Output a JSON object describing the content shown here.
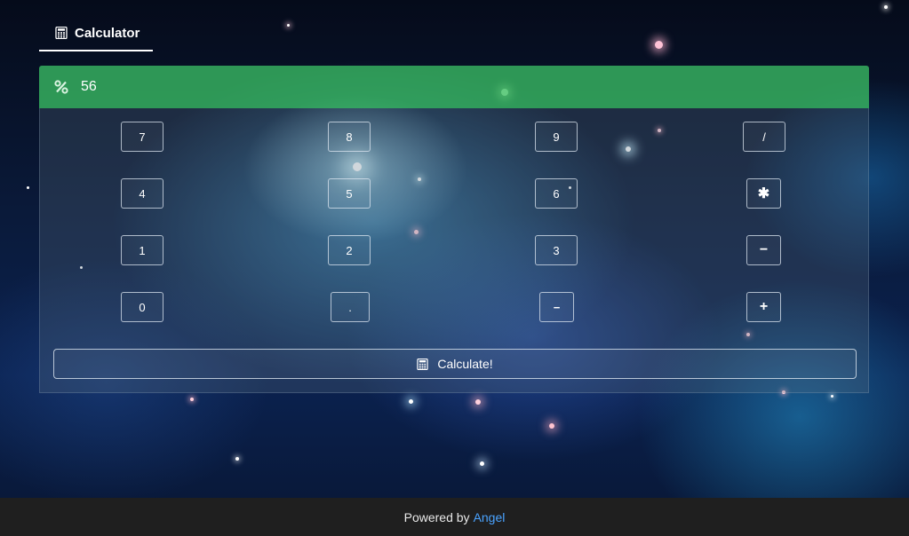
{
  "nav": {
    "tab_label": "Calculator",
    "tab_icon": "calculator-icon"
  },
  "display": {
    "value": "56",
    "icon": "percent-icon",
    "color": "#3abe64"
  },
  "keypad": {
    "row1": [
      "7",
      "8",
      "9",
      "/"
    ],
    "row2": [
      "4",
      "5",
      "6",
      "✱"
    ],
    "row3": [
      "1",
      "2",
      "3",
      "−"
    ],
    "row4": [
      "0",
      ".",
      "−",
      "+"
    ]
  },
  "calculate": {
    "label": "Calculate!",
    "icon": "calculator-icon"
  },
  "footer": {
    "prefix": "Powered by",
    "link": "Angel",
    "link_color": "#4aa3ff"
  }
}
